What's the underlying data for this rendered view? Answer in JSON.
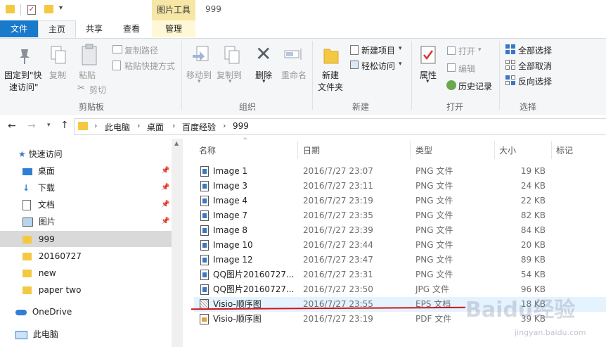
{
  "window": {
    "context_tab": "图片工具",
    "title": "999"
  },
  "ribbon_tabs": [
    {
      "label": "文件"
    },
    {
      "label": "主页"
    },
    {
      "label": "共享"
    },
    {
      "label": "查看"
    },
    {
      "label": "管理"
    }
  ],
  "ribbon": {
    "clipboard": {
      "pin_label_1": "固定到\"快",
      "pin_label_2": "速访问\"",
      "copy": "复制",
      "paste": "粘贴",
      "copy_path": "复制路径",
      "paste_shortcut": "粘贴快捷方式",
      "cut": "剪切",
      "group": "剪贴板"
    },
    "organize": {
      "move_to": "移动到",
      "copy_to": "复制到",
      "delete": "删除",
      "rename": "重命名",
      "group": "组织"
    },
    "new": {
      "new_folder_1": "新建",
      "new_folder_2": "文件夹",
      "new_item": "新建项目",
      "easy_access": "轻松访问",
      "group": "新建"
    },
    "open": {
      "properties": "属性",
      "open": "打开",
      "edit": "编辑",
      "history": "历史记录",
      "group": "打开"
    },
    "select": {
      "select_all": "全部选择",
      "select_none": "全部取消",
      "invert": "反向选择",
      "group": "选择"
    }
  },
  "address": {
    "crumbs": [
      "此电脑",
      "桌面",
      "百度经验",
      "999"
    ]
  },
  "nav": {
    "quick_access": "快速访问",
    "items": [
      {
        "label": "桌面",
        "icon": "desktop-icon",
        "pinned": true
      },
      {
        "label": "下载",
        "icon": "download-icon",
        "pinned": true
      },
      {
        "label": "文档",
        "icon": "documents-icon",
        "pinned": true
      },
      {
        "label": "图片",
        "icon": "pictures-icon",
        "pinned": true
      },
      {
        "label": "999",
        "icon": "folder-icon",
        "pinned": false,
        "selected": true
      },
      {
        "label": "20160727",
        "icon": "folder-icon",
        "pinned": false
      },
      {
        "label": "new",
        "icon": "folder-icon",
        "pinned": false
      },
      {
        "label": "paper two",
        "icon": "folder-icon",
        "pinned": false
      }
    ],
    "onedrive": "OneDrive",
    "this_pc": "此电脑"
  },
  "columns": [
    "名称",
    "日期",
    "类型",
    "大小",
    "标记"
  ],
  "files": [
    {
      "name": "Image 1",
      "date": "2016/7/27 23:07",
      "type": "PNG 文件",
      "size": "19 KB"
    },
    {
      "name": "Image 3",
      "date": "2016/7/27 23:11",
      "type": "PNG 文件",
      "size": "24 KB"
    },
    {
      "name": "Image 4",
      "date": "2016/7/27 23:19",
      "type": "PNG 文件",
      "size": "22 KB"
    },
    {
      "name": "Image 7",
      "date": "2016/7/27 23:35",
      "type": "PNG 文件",
      "size": "82 KB"
    },
    {
      "name": "Image 8",
      "date": "2016/7/27 23:39",
      "type": "PNG 文件",
      "size": "84 KB"
    },
    {
      "name": "Image 10",
      "date": "2016/7/27 23:44",
      "type": "PNG 文件",
      "size": "20 KB"
    },
    {
      "name": "Image 12",
      "date": "2016/7/27 23:47",
      "type": "PNG 文件",
      "size": "89 KB"
    },
    {
      "name": "QQ图片20160727...",
      "date": "2016/7/27 23:31",
      "type": "PNG 文件",
      "size": "54 KB"
    },
    {
      "name": "QQ图片20160727...",
      "date": "2016/7/27 23:50",
      "type": "JPG 文件",
      "size": "96 KB"
    },
    {
      "name": "Visio-顺序图",
      "date": "2016/7/27 23:55",
      "type": "EPS 文档",
      "size": "18 KB"
    },
    {
      "name": "Visio-顺序图",
      "date": "2016/7/27 23:19",
      "type": "PDF 文件",
      "size": "39 KB"
    }
  ],
  "watermark": {
    "brand": "Baidu经验",
    "url": "jingyan.baidu.com"
  },
  "colors": {
    "file_tab": "#1979ca",
    "context_tab": "#f6e7a6",
    "selection": "#d9d9d9",
    "annotation": "#d0141e"
  }
}
